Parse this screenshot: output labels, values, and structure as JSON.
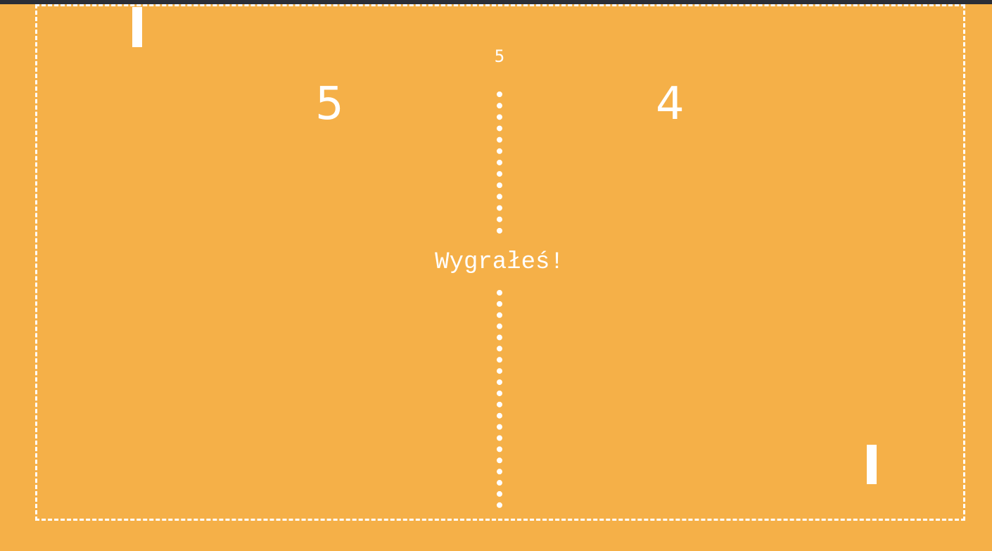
{
  "game": {
    "target_score": "5",
    "score_left": "5",
    "score_right": "4",
    "message": "Wygrałeś!"
  },
  "colors": {
    "background": "#F5B048",
    "foreground": "#FFFFFF",
    "topbar": "#2B2E36"
  }
}
